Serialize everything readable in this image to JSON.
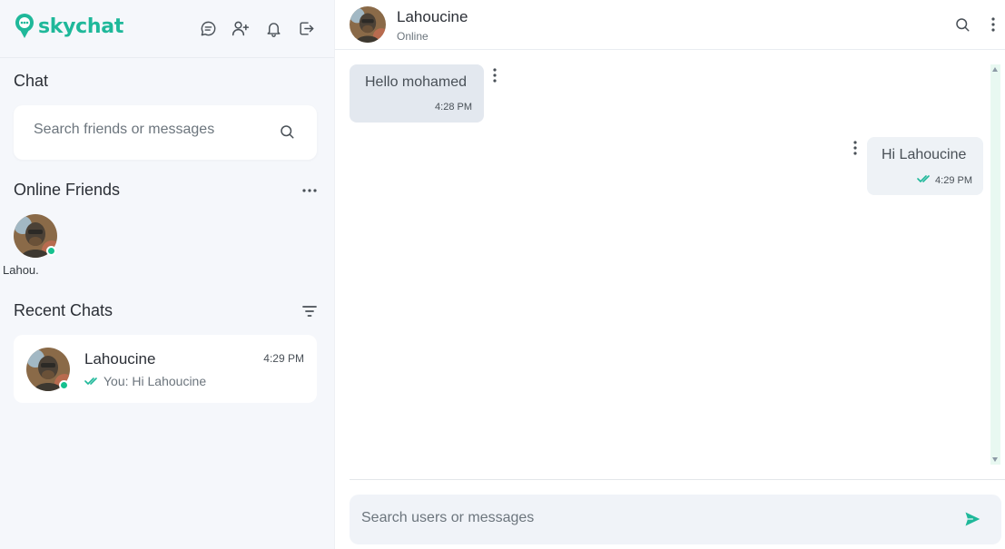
{
  "brand": {
    "name": "skychat",
    "accent": "#1fb89a"
  },
  "top_icons": [
    {
      "icon": "chat-bubble-icon"
    },
    {
      "icon": "add-user-icon"
    },
    {
      "icon": "bell-icon"
    },
    {
      "icon": "logout-icon"
    }
  ],
  "sidebar": {
    "chat_title": "Chat",
    "search_placeholder": "Search friends or messages",
    "online_friends_title": "Online Friends",
    "online_friends": [
      {
        "name": "Lahou.",
        "status": "online"
      }
    ],
    "recent_chats_title": "Recent Chats",
    "recent_chats": [
      {
        "name": "Lahoucine",
        "time": "4:29 PM",
        "preview": "You: Hi Lahoucine",
        "status": "online",
        "read": true
      }
    ]
  },
  "conversation": {
    "contact_name": "Lahoucine",
    "contact_status": "Online",
    "messages": [
      {
        "direction": "incoming",
        "text": "Hello mohamed",
        "time": "4:28 PM"
      },
      {
        "direction": "outgoing",
        "text": "Hi Lahoucine",
        "time": "4:29 PM",
        "read": true
      }
    ],
    "composer_placeholder": "Search users or messages"
  },
  "colors": {
    "online": "#16c18f",
    "read_tick": "#1fb89a",
    "sidebar_bg": "#f5f7fb"
  }
}
